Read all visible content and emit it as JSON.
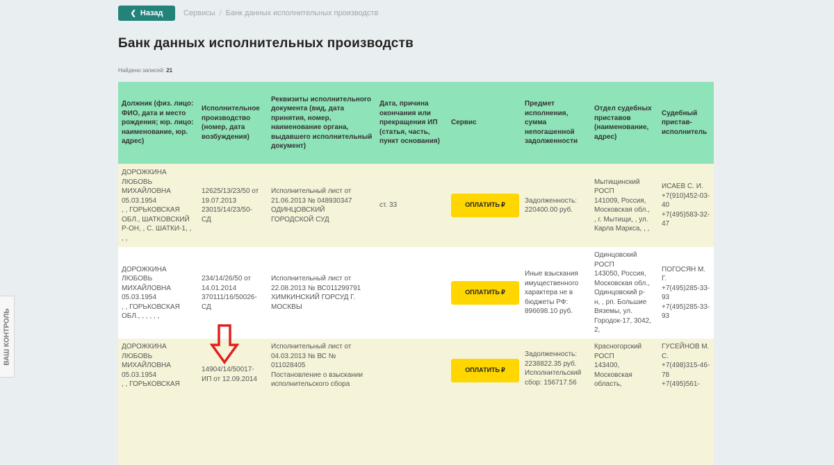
{
  "nav": {
    "back_label": "Назад",
    "breadcrumb": [
      "Сервисы",
      "/",
      "Банк данных исполнительных производств"
    ]
  },
  "page_title": "Банк данных исполнительных производств",
  "records": {
    "label": "Найдено записей:",
    "count": "21"
  },
  "table": {
    "headers": [
      "Должник (физ. лицо: ФИО, дата и место рождения; юр. лицо: наименование, юр. адрес)",
      "Исполнительное производство (номер, дата возбуждения)",
      "Реквизиты исполнительного документа (вид, дата принятия, номер, наименование органа, выдавшего исполнительный документ)",
      "Дата, причина окончания или прекращения ИП (статья, часть, пункт основания)",
      "Сервис",
      "Предмет исполнения, сумма непогашенной задолженности",
      "Отдел судебных приставов (наименование, адрес)",
      "Судебный пристав-исполнитель"
    ],
    "pay_label": "ОПЛАТИТЬ",
    "pay_icon": "₽",
    "rows": [
      {
        "debtor": "ДОРОЖКИНА\nЛЮБОВЬ\nМИХАЙЛОВНА\n05.03.1954\n, , ГОРЬКОВСКАЯ\nОБЛ., ШАТКОВСКИЙ\nР-ОН, , С. ШАТКИ-1, ,\n, ,",
        "proceeding": "12625/13/23/50 от\n19.07.2013\n23015/14/23/50-\nСД",
        "document": "Исполнительный лист от\n21.06.2013 № 048930347\nОДИНЦОВСКИЙ\nГОРОДСКОЙ СУД",
        "end": "ст. 33",
        "subject": "Задолженность:\n220400.00 руб.",
        "department": "Мытищинский\nРОСП\n141009, Россия,\nМосковская обл.,\n, г. Мытищи, , ул.\nКарла Маркса, , ,",
        "bailiff": "ИСАЕВ С. И.\n+7(910)452-03-\n40\n+7(495)583-32-\n47"
      },
      {
        "debtor": "ДОРОЖКИНА\nЛЮБОВЬ\nМИХАЙЛОВНА\n05.03.1954\n, , ГОРЬКОВСКАЯ\nОБЛ., , , , , ,",
        "proceeding": "234/14/26/50 от\n14.01.2014\n370111/16/50026-\nСД",
        "document": "Исполнительный лист от\n22.08.2013 № ВС011299791\nХИМКИНСКИЙ ГОРСУД Г.\nМОСКВЫ",
        "end": "",
        "subject": "Иные взыскания\nимущественного\nхарактера не в\nбюджеты РФ:\n896698.10 руб.",
        "department": "Одинцовский\nРОСП\n143050, Россия,\nМосковская обл.,\nОдинцовский р-\nн, , рп. Большие\nВяземы, ул.\nГородок-17, 3042,\n2,",
        "bailiff": "ПОГОСЯН М.\nГ.\n+7(495)285-33-\n93\n+7(495)285-33-\n93"
      },
      {
        "debtor": "ДОРОЖКИНА\nЛЮБОВЬ\nМИХАЙЛОВНА\n05.03.1954\n, , ГОРЬКОВСКАЯ",
        "proceeding": "14904/14/50017-\nИП от 12.09.2014",
        "document": "Исполнительный лист от\n04.03.2013 № ВС №\n011028405\nПостановление о взыскании\nисполнительского сбора",
        "end": "",
        "subject": "Задолженность:\n2238822.35 руб.\nИсполнительский\nсбор: 156717.56",
        "department": "Красногорский\nРОСП\n143400,\nМосковская\nобласть,",
        "bailiff": "ГУСЕЙНОВ М.\nС.\n+7(498)315-46-\n78\n+7(495)561-"
      }
    ]
  },
  "side_tab_label": "ВАШ КОНТРОЛЬ",
  "colors": {
    "accent": "#23837b",
    "header_bg": "#8fe3b9",
    "pay_button": "#ffd600",
    "arrow": "#e02020"
  }
}
